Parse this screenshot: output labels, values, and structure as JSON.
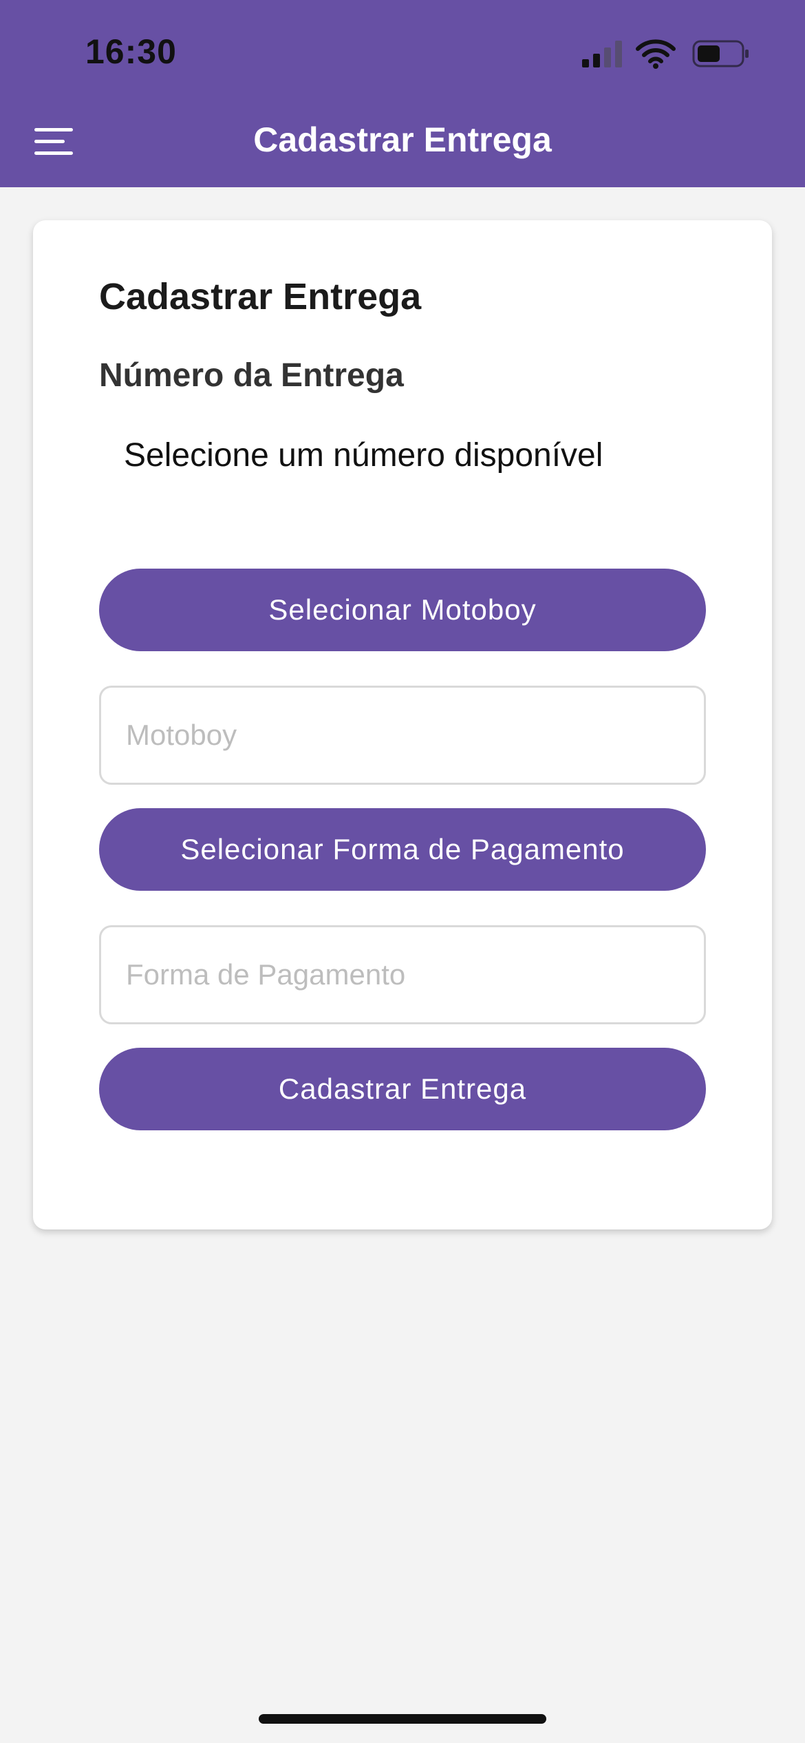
{
  "status_bar": {
    "time": "16:30",
    "icons": [
      "signal-icon",
      "wifi-icon",
      "battery-icon"
    ],
    "battery_level": 0.45
  },
  "header": {
    "menu_icon": "menu-icon",
    "title": "Cadastrar Entrega",
    "background_color": "#6750a4"
  },
  "form": {
    "title": "Cadastrar Entrega",
    "number_label": "Número da Entrega",
    "number_select_value": "Selecione um número disponível",
    "select_motoboy_button": "Selecionar Motoboy",
    "motoboy_placeholder": "Motoboy",
    "motoboy_value": "",
    "select_payment_button": "Selecionar Forma de Pagamento",
    "payment_placeholder": "Forma de Pagamento",
    "payment_value": "",
    "submit_button": "Cadastrar Entrega"
  },
  "colors": {
    "accent": "#6750a4",
    "background": "#f3f3f3"
  }
}
